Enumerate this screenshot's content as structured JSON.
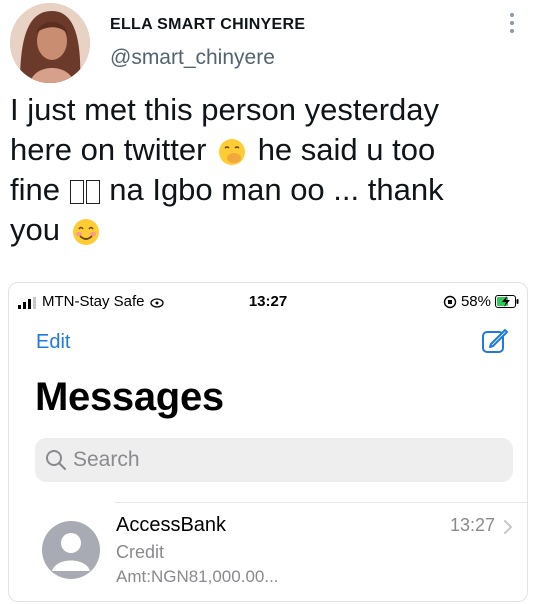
{
  "tweet": {
    "display_name": "ELLA SMART CHINYERE",
    "handle": "@smart_chinyere",
    "line1": "I just met this person yesterday",
    "line2a": "here on twitter",
    "line2b": "he said u too",
    "line3a": "fine",
    "line3b": "na Igbo man oo ... thank",
    "line4": "you",
    "emoji1": "hand-over-mouth-emoji",
    "emoji2": "smiling-face-emoji"
  },
  "screenshot": {
    "status": {
      "carrier": "MTN-Stay Safe",
      "time": "13:27",
      "battery": "58%"
    },
    "edit_label": "Edit",
    "title": "Messages",
    "search_placeholder": "Search",
    "message": {
      "sender": "AccessBank",
      "time": "13:27",
      "preview_line1": "Credit",
      "preview_line2": "Amt:NGN81,000.00..."
    }
  },
  "colors": {
    "ios_blue": "#1e7ae0",
    "secondary_gray": "#8a8a8e",
    "battery_green": "#34c759"
  }
}
